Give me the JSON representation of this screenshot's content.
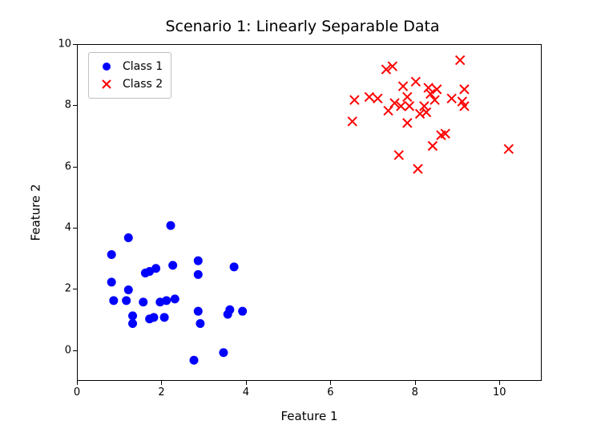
{
  "chart_data": {
    "type": "scatter",
    "title": "Scenario 1: Linearly Separable Data",
    "xlabel": "Feature 1",
    "ylabel": "Feature 2",
    "xlim": [
      0,
      11
    ],
    "ylim": [
      -1,
      10
    ],
    "xticks": [
      0,
      2,
      4,
      6,
      8,
      10
    ],
    "yticks": [
      0,
      2,
      4,
      6,
      8,
      10
    ],
    "legend_position": "upper left",
    "series": [
      {
        "name": "Class 1",
        "marker": "o",
        "color": "#0000ff",
        "x": [
          0.8,
          0.8,
          0.85,
          1.15,
          1.2,
          1.2,
          1.3,
          1.3,
          1.55,
          1.6,
          1.7,
          1.7,
          1.8,
          1.85,
          1.95,
          2.05,
          2.1,
          2.2,
          2.25,
          2.3,
          2.75,
          2.85,
          2.85,
          2.85,
          2.9,
          3.45,
          3.55,
          3.6,
          3.7,
          3.9
        ],
        "y": [
          3.15,
          2.25,
          1.65,
          1.65,
          2.0,
          3.7,
          1.15,
          0.9,
          1.6,
          2.55,
          1.05,
          2.6,
          1.1,
          2.7,
          1.6,
          1.1,
          1.65,
          4.1,
          2.8,
          1.7,
          -0.3,
          2.95,
          2.5,
          1.3,
          0.9,
          -0.05,
          1.2,
          1.35,
          2.75,
          1.3
        ]
      },
      {
        "name": "Class 2",
        "marker": "x",
        "color": "#ff0000",
        "x": [
          6.5,
          6.55,
          6.9,
          7.1,
          7.3,
          7.35,
          7.45,
          7.5,
          7.6,
          7.65,
          7.7,
          7.8,
          7.8,
          7.85,
          8.0,
          8.05,
          8.1,
          8.2,
          8.25,
          8.3,
          8.35,
          8.4,
          8.45,
          8.5,
          8.6,
          8.7,
          8.85,
          9.05,
          9.1,
          9.15,
          9.15,
          10.2
        ],
        "y": [
          7.5,
          8.2,
          8.3,
          8.25,
          9.2,
          7.85,
          9.3,
          8.1,
          6.4,
          8.0,
          8.65,
          8.3,
          7.45,
          8.0,
          8.8,
          5.95,
          7.75,
          8.0,
          7.8,
          8.6,
          8.4,
          6.7,
          8.2,
          8.55,
          7.05,
          7.1,
          8.25,
          9.5,
          8.15,
          8.55,
          8.0,
          6.6
        ]
      }
    ]
  }
}
